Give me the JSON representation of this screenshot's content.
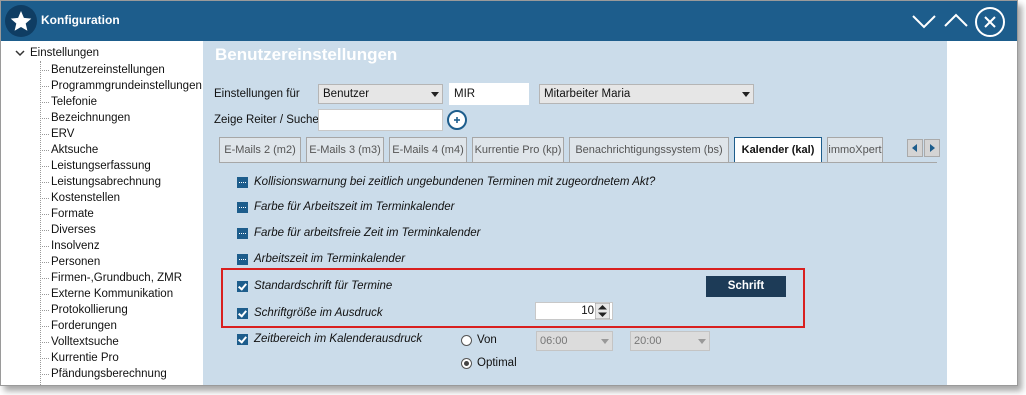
{
  "window": {
    "title": "Konfiguration",
    "buttons": [
      "chevron-down-icon",
      "chevron-up-icon",
      "close-icon"
    ],
    "accent_color": "#1d5d8c"
  },
  "tree": {
    "root": "Einstellungen",
    "items": [
      "Benutzereinstellungen",
      "Programmgrundeinstellungen",
      "Telefonie",
      "Bezeichnungen",
      "ERV",
      "Aktsuche",
      "Leistungserfassung",
      "Leistungsabrechnung",
      "Kostenstellen",
      "Formate",
      "Diverses",
      "Insolvenz",
      "Personen",
      "Firmen-,Grundbuch, ZMR",
      "Externe Kommunikation",
      "Protokollierung",
      "Forderungen",
      "Volltextsuche",
      "Kurrentie Pro",
      "Pfändungsberechnung"
    ]
  },
  "main": {
    "title": "Benutzereinstellungen",
    "settings_for_label": "Einstellungen für",
    "settings_for_value": "Benutzer",
    "user_code": "MIR",
    "user_name": "Mitarbeiter Maria",
    "search_label": "Zeige Reiter / Suche",
    "search_value": ""
  },
  "tabs": [
    {
      "label": "E-Mails 2 (m2)",
      "active": false
    },
    {
      "label": "E-Mails 3 (m3)",
      "active": false
    },
    {
      "label": "E-Mails 4 (m4)",
      "active": false
    },
    {
      "label": "Kurrentie Pro (kp)",
      "active": false
    },
    {
      "label": "Benachrichtigungssystem (bs)",
      "active": false
    },
    {
      "label": "Kalender (kal)",
      "active": true
    },
    {
      "label": "immoXpert",
      "active": false
    }
  ],
  "options": {
    "collision": "Kollisionswarnung bei zeitlich ungebundenen Terminen mit zugeordnetem Akt?",
    "work_color": "Farbe für Arbeitszeit im Terminkalender",
    "free_color": "Farbe für arbeitsfreie Zeit im Terminkalender",
    "work_time": "Arbeitszeit im Terminkalender",
    "std_font": "Standardschrift für Termine",
    "font_button": "Schrift",
    "print_size": "Schriftgröße im Ausdruck",
    "print_size_value": "10",
    "range": "Zeitbereich im Kalenderausdruck",
    "range_from": "Von",
    "range_optimal": "Optimal",
    "time_from": "06:00",
    "time_to": "20:00"
  }
}
